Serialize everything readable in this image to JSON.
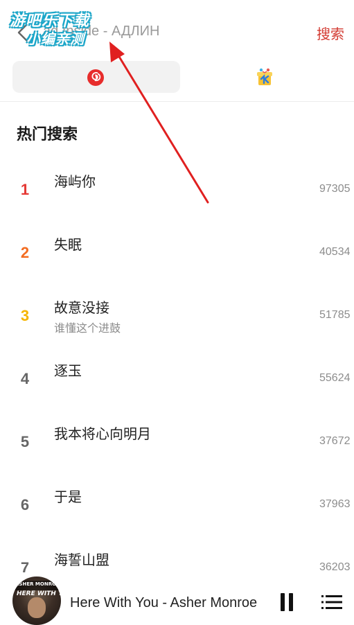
{
  "header": {
    "search_query": "ad Inside - АДЛИН",
    "search_button": "搜索"
  },
  "watermark": {
    "line1": "游吧乐下载",
    "line2": "小编亲测"
  },
  "tabs": [
    {
      "id": "netease",
      "icon": "netease-music-icon",
      "active": true
    },
    {
      "id": "kugou",
      "icon": "kugou-icon",
      "active": false
    }
  ],
  "hot_search": {
    "title": "热门搜索",
    "items": [
      {
        "rank": "1",
        "title": "海屿你",
        "subtitle": "",
        "count": "97305",
        "rank_color": "#e53935"
      },
      {
        "rank": "2",
        "title": "失眠",
        "subtitle": "",
        "count": "40534",
        "rank_color": "#f36c21"
      },
      {
        "rank": "3",
        "title": "故意没接",
        "subtitle": "谁懂这个进鼓",
        "count": "51785",
        "rank_color": "#f5b400"
      },
      {
        "rank": "4",
        "title": "逐玉",
        "subtitle": "",
        "count": "55624",
        "rank_color": "#666666"
      },
      {
        "rank": "5",
        "title": "我本将心向明月",
        "subtitle": "",
        "count": "37672",
        "rank_color": "#666666"
      },
      {
        "rank": "6",
        "title": "于是",
        "subtitle": "",
        "count": "37963",
        "rank_color": "#666666"
      },
      {
        "rank": "7",
        "title": "海誓山盟",
        "subtitle": "",
        "count": "36203",
        "rank_color": "#666666"
      }
    ]
  },
  "player": {
    "cover_text_top": "ASHER MONROE",
    "cover_text_title": "HERE WITH YOU",
    "now_playing": "Here With You - Asher Monroe"
  },
  "colors": {
    "accent": "#d33a31",
    "arrow": "#e02020"
  }
}
